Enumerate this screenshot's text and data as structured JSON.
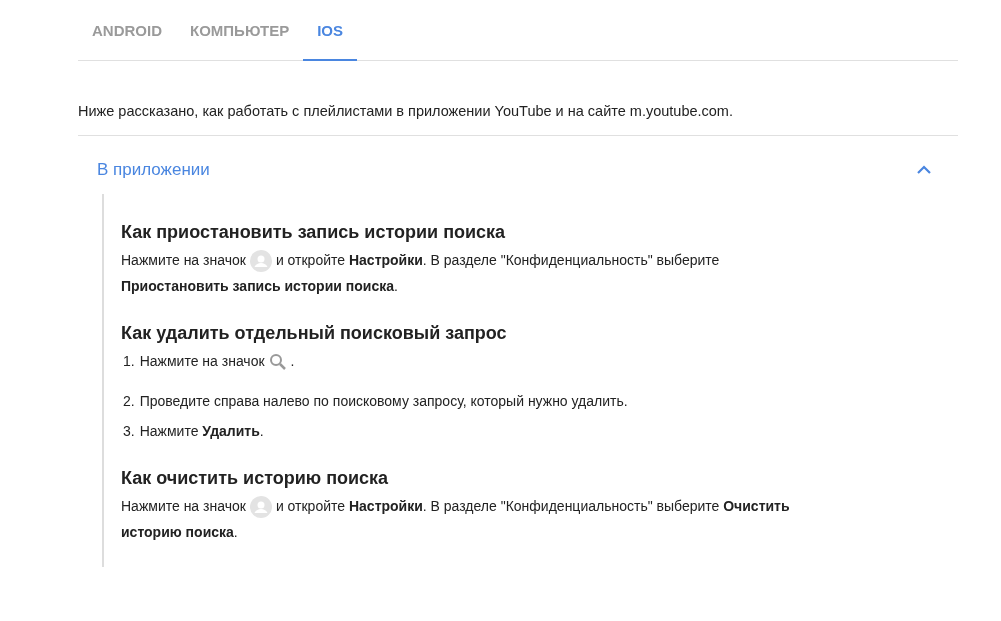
{
  "tabs": [
    {
      "label": "ANDROID",
      "selected": false
    },
    {
      "label": "КОМПЬЮТЕР",
      "selected": false
    },
    {
      "label": "IOS",
      "selected": true
    }
  ],
  "intro": "Ниже рассказано, как работать с плейлистами в приложении YouTube и на сайте m.youtube.com.",
  "accordion": {
    "title": "В приложении",
    "expanded": true,
    "sections": [
      {
        "heading": "Как приостановить запись истории поиска",
        "kind": "paragraph",
        "lines": [
          [
            {
              "kind": "text",
              "text": "Нажмите на значок"
            },
            {
              "kind": "avatar"
            },
            {
              "kind": "text",
              "text": "и откройте **Настройки**. В разделе \"Конфиденциальность\" выберите"
            }
          ],
          [
            {
              "kind": "text",
              "text": "**Приостановить запись истории поиска**."
            }
          ]
        ]
      },
      {
        "heading": "Как удалить отдельный поисковый запрос",
        "kind": "list",
        "items": [
          {
            "number": "1.",
            "parts": [
              {
                "kind": "text",
                "text": "Нажмите на значок"
              },
              {
                "kind": "search"
              },
              {
                "kind": "text",
                "text": "."
              }
            ]
          },
          {
            "number": "2.",
            "parts": [
              {
                "kind": "text",
                "text": "Проведите справа налево по поисковому запросу, который нужно удалить."
              }
            ]
          },
          {
            "number": "3.",
            "parts": [
              {
                "kind": "text",
                "text": "Нажмите **Удалить**."
              }
            ]
          }
        ]
      },
      {
        "heading": "Как очистить историю поиска",
        "kind": "paragraph",
        "lines": [
          [
            {
              "kind": "text",
              "text": "Нажмите на значок"
            },
            {
              "kind": "avatar"
            },
            {
              "kind": "text",
              "text": "и откройте **Настройки**. В разделе \"Конфиденциальность\" выберите **Очистить**"
            }
          ],
          [
            {
              "kind": "text",
              "text": "**историю поиска**."
            }
          ]
        ]
      }
    ]
  }
}
